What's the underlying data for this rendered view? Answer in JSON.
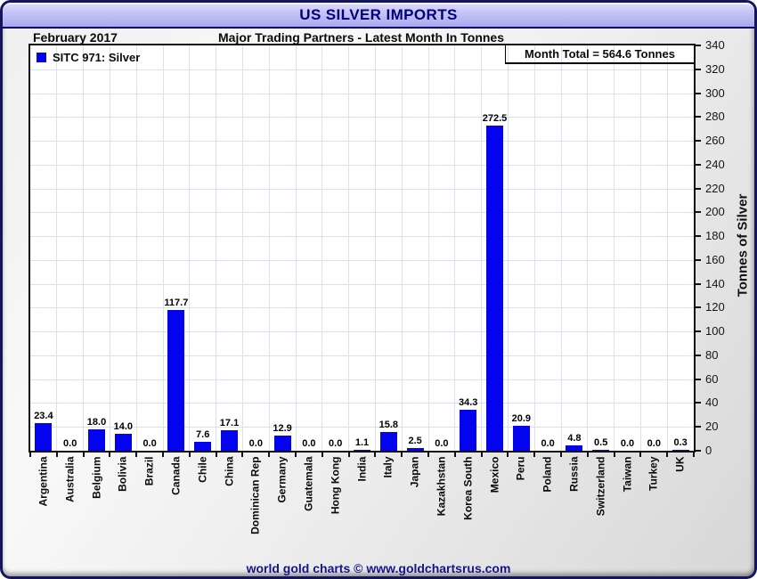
{
  "header": {
    "title": "US SILVER IMPORTS",
    "period": "February 2017",
    "subtitle": "Major Trading Partners - Latest Month In Tonnes"
  },
  "legend": {
    "label": "SITC 971: Silver"
  },
  "annotations": {
    "month_total": "Month Total = 564.6 Tonnes"
  },
  "axes": {
    "y_title": "Tonnes of Silver"
  },
  "footer": {
    "text": "world gold charts © www.goldchartsrus.com"
  },
  "colors": {
    "bar": "#0303f0",
    "grid": "#d8e2f0",
    "title_navy": "#00007a",
    "footer_navy": "#14148c"
  },
  "chart_data": {
    "type": "bar",
    "title": "US SILVER IMPORTS",
    "subtitle": "Major Trading Partners - Latest Month In Tonnes",
    "period": "February 2017",
    "series_name": "SITC 971: Silver",
    "categories": [
      "Argentina",
      "Australia",
      "Belgium",
      "Bolivia",
      "Brazil",
      "Canada",
      "Chile",
      "China",
      "Dominican Rep",
      "Germany",
      "Guatemala",
      "Hong Kong",
      "India",
      "Italy",
      "Japan",
      "Kazakhstan",
      "Korea South",
      "Mexico",
      "Peru",
      "Poland",
      "Russia",
      "Switzerland",
      "Taiwan",
      "Turkey",
      "UK"
    ],
    "values": [
      23.4,
      0.0,
      18.0,
      14.0,
      0.0,
      117.7,
      7.6,
      17.1,
      0.0,
      12.9,
      0.0,
      0.0,
      1.1,
      15.8,
      2.5,
      0.0,
      34.3,
      272.5,
      20.9,
      0.0,
      4.8,
      0.5,
      0.0,
      0.0,
      0.3
    ],
    "value_labels": true,
    "month_total_tonnes": 564.6,
    "ylabel": "Tonnes of Silver",
    "ylim": [
      0,
      340
    ],
    "ytick_step": 20,
    "grid": true,
    "legend_position": "top-left",
    "bar_color": "#0303f0"
  }
}
